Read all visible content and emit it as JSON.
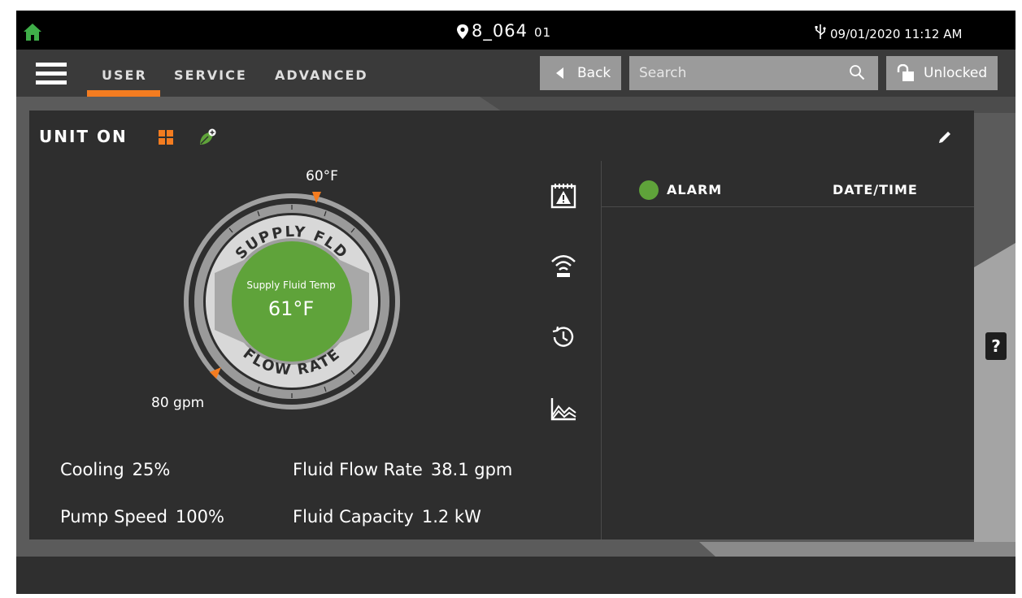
{
  "status": {
    "unit_id": "8_064",
    "unit_sub": "01",
    "datetime": "09/01/2020 11:12 AM"
  },
  "nav": {
    "tabs": [
      {
        "label": "USER"
      },
      {
        "label": "SERVICE"
      },
      {
        "label": "ADVANCED"
      }
    ],
    "back_label": "Back",
    "search_placeholder": "Search",
    "lock_label": "Unlocked"
  },
  "panel": {
    "unit_status": "UNIT ON",
    "gauge": {
      "setpoint_label": "60°F",
      "flow_limit_label": "80 gpm",
      "top_arc_text": "SUPPLY FLD",
      "bottom_arc_text": "FLOW RATE",
      "caption": "Supply Fluid Temp",
      "value": "61°F"
    },
    "stats": [
      {
        "label": "Cooling",
        "value": "25%"
      },
      {
        "label": "Fluid Flow Rate",
        "value": "38.1 gpm"
      },
      {
        "label": "Pump Speed",
        "value": "100%"
      },
      {
        "label": "Fluid Capacity",
        "value": "1.2 kW"
      }
    ],
    "alarm_table": {
      "col_alarm": "ALARM",
      "col_datetime": "DATE/TIME"
    },
    "side_icons": [
      "alarm-calendar-icon",
      "wireless-icon",
      "history-icon",
      "trend-chart-icon"
    ]
  },
  "help_label": "?",
  "colors": {
    "accent": "#f47c20",
    "status_green": "#5fa33a",
    "home_green": "#3fae49",
    "panel": "#2e2e2e"
  }
}
